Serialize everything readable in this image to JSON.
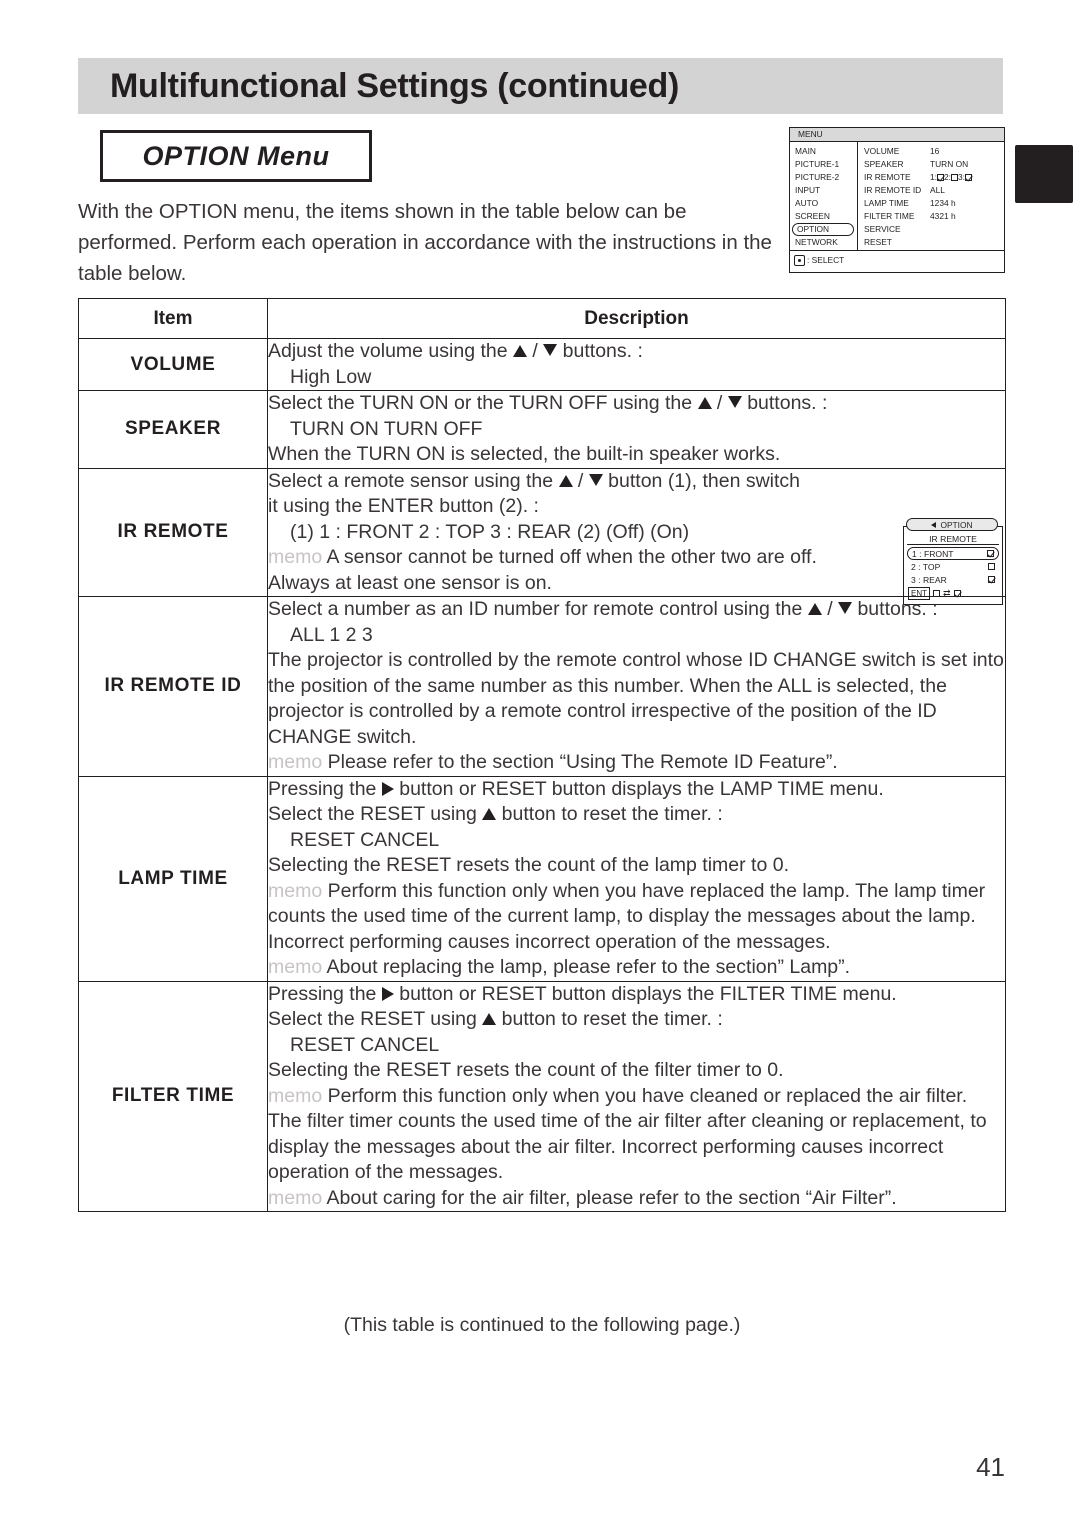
{
  "header": {
    "title": "Multifunctional Settings (continued)"
  },
  "section": {
    "title": "OPTION Menu"
  },
  "intro": "With the  OPTION menu, the items shown in the table below can be performed. Perform each operation in accordance with the instructions in the table below.",
  "osd_main": {
    "titlebar": "MENU",
    "left_items": [
      "MAIN",
      "PICTURE-1",
      "PICTURE-2",
      "INPUT",
      "AUTO",
      "SCREEN",
      "OPTION",
      "NETWORK"
    ],
    "selected_left": "OPTION",
    "rows": [
      {
        "key": "VOLUME",
        "value": "16"
      },
      {
        "key": "SPEAKER",
        "value": "TURN ON"
      },
      {
        "key": "IR REMOTE",
        "value": "1:☑ 2:☐ 3:☑"
      },
      {
        "key": "IR REMOTE ID",
        "value": "ALL"
      },
      {
        "key": "LAMP TIME",
        "value": "1234 h"
      },
      {
        "key": "FILTER TIME",
        "value": "4321 h"
      },
      {
        "key": "SERVICE",
        "value": ""
      },
      {
        "key": "RESET",
        "value": ""
      }
    ],
    "footer": ": SELECT"
  },
  "osd_sub": {
    "tab_label": "OPTION",
    "heading": "IR REMOTE",
    "lines": [
      {
        "label": "1 : FRONT",
        "checked": true,
        "selected": true
      },
      {
        "label": "2 : TOP",
        "checked": false,
        "selected": false
      },
      {
        "label": "3 : REAR",
        "checked": true,
        "selected": false
      }
    ],
    "ent_key": "ENT",
    "ent_swap": "⇄"
  },
  "table": {
    "headers": {
      "item": "Item",
      "description": "Description"
    },
    "rows": [
      {
        "item": "VOLUME",
        "lines": [
          {
            "type": "text",
            "before": "Adjust the volume using the ",
            "mid": " / ",
            "after": " buttons. :"
          },
          {
            "type": "indent",
            "text": "High     Low"
          }
        ]
      },
      {
        "item": "SPEAKER",
        "lines": [
          {
            "type": "text",
            "before": "Select the TURN ON or the TURN OFF using the ",
            "mid": " / ",
            "after": " buttons. :"
          },
          {
            "type": "indent",
            "text": "TURN ON     TURN OFF"
          },
          {
            "type": "plain",
            "text": "When the TURN ON is selected, the built-in speaker works."
          }
        ]
      },
      {
        "item": "IR REMOTE",
        "lines": [
          {
            "type": "text2",
            "before": "Select a remote sensor using the ",
            "mid": " / ",
            "after": " button (1), then switch"
          },
          {
            "type": "plain",
            "text": "it using the ENTER button (2). :"
          },
          {
            "type": "indent",
            "text": "(1) 1 : FRONT     2 : TOP     3 : REAR  (2)     (Off)           (On)"
          },
          {
            "type": "memo",
            "memo": "memo",
            "text": " A sensor cannot be turned off when the other two are off."
          },
          {
            "type": "plain",
            "text": "Always at least one sensor is on."
          }
        ]
      },
      {
        "item": "IR REMOTE ID",
        "lines": [
          {
            "type": "text",
            "before": "Select a number as an ID number for remote control using the ",
            "mid": " / ",
            "after": " buttons. :"
          },
          {
            "type": "indent",
            "text": "ALL     1     2     3"
          },
          {
            "type": "plain",
            "text": "The projector is controlled by the remote control whose ID CHANGE switch is set into the position of the same number as this number. When the ALL is selected, the projector is controlled by a remote control irrespective of the position of the ID CHANGE switch."
          },
          {
            "type": "memo",
            "memo": "memo",
            "text": " Please refer to the section “Using The Remote ID Feature”."
          }
        ]
      },
      {
        "item": "LAMP TIME",
        "lines": [
          {
            "type": "rt",
            "before": "Pressing the ",
            "after": " button or RESET button displays the LAMP TIME menu."
          },
          {
            "type": "up",
            "before": "Select the RESET using ",
            "after": " button to reset the timer. :"
          },
          {
            "type": "indent",
            "text": "RESET     CANCEL"
          },
          {
            "type": "plain",
            "text": "Selecting the RESET resets the count of the lamp timer to 0."
          },
          {
            "type": "memo",
            "memo": "memo",
            "text": " Perform this function only when you have replaced the lamp. The lamp timer counts the used time of the current lamp, to display the messages about the lamp. Incorrect performing causes incorrect operation of the messages."
          },
          {
            "type": "memo",
            "memo": "memo",
            "text": " About replacing the lamp, please refer to the section” Lamp”."
          }
        ]
      },
      {
        "item": "FILTER TIME",
        "lines": [
          {
            "type": "rt",
            "before": "Pressing the ",
            "after": " button or RESET button displays the FILTER TIME menu."
          },
          {
            "type": "up",
            "before": "Select the RESET using ",
            "after": " button to reset the timer. :"
          },
          {
            "type": "indent",
            "text": "RESET     CANCEL"
          },
          {
            "type": "plain",
            "text": "Selecting the RESET resets the count of the filter timer to 0."
          },
          {
            "type": "memo",
            "memo": "memo",
            "text": " Perform this function only when you have cleaned or replaced the air filter. The filter timer counts the used time of the air filter after cleaning or replacement, to display the messages about the air filter. Incorrect performing causes incorrect operation of the messages."
          },
          {
            "type": "memo",
            "memo": "memo",
            "text": " About caring for the air filter, please refer to the section “Air Filter”."
          }
        ]
      }
    ]
  },
  "footer": {
    "continued_note": "(This table is continued to the following page.)",
    "page_number": "41"
  }
}
